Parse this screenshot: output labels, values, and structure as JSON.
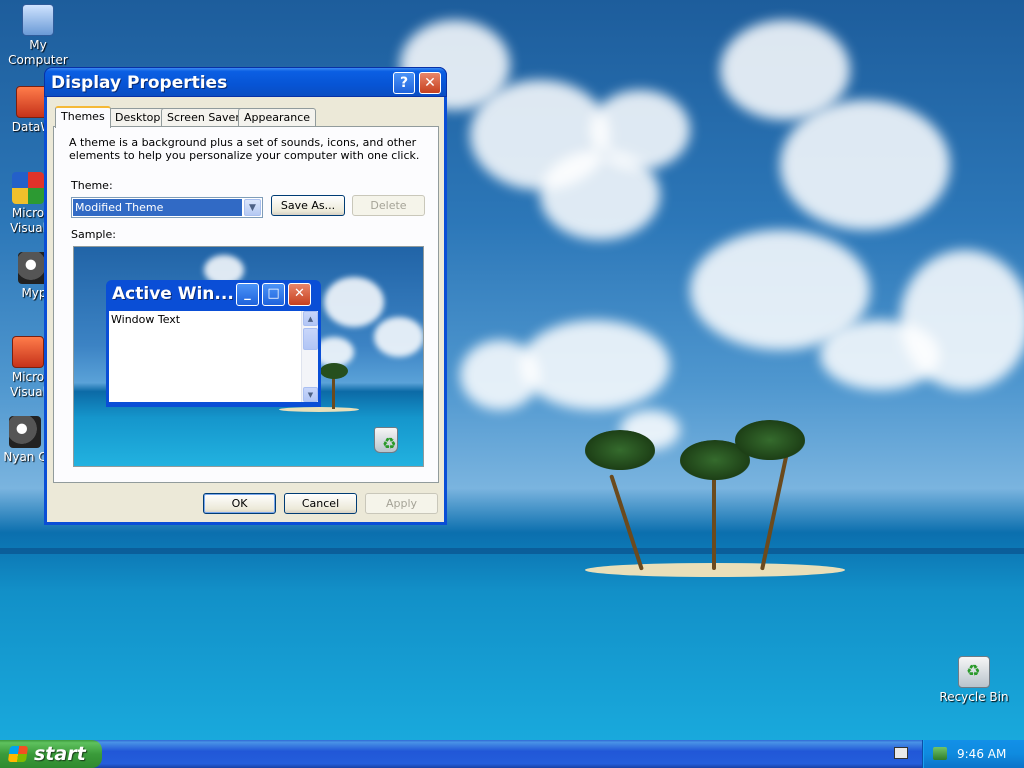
{
  "desktop": {
    "icons": [
      {
        "label": "My Computer",
        "icon": "computer-icon"
      },
      {
        "label": "DataW",
        "icon": "app-shortcut-icon"
      },
      {
        "label": "Micro Visual",
        "icon": "visual-studio-icon"
      },
      {
        "label": "Myp",
        "icon": "cat-icon"
      },
      {
        "label": "Micro Visual",
        "icon": "app-shortcut-icon"
      },
      {
        "label": "Nyan C",
        "icon": "cat-icon"
      },
      {
        "label": "Recycle Bin",
        "icon": "recycle-bin-icon"
      }
    ]
  },
  "dialog": {
    "title": "Display Properties",
    "help_button": "?",
    "close_button": "✕",
    "tabs": [
      {
        "label": "Themes",
        "active": true
      },
      {
        "label": "Desktop"
      },
      {
        "label": "Screen Saver"
      },
      {
        "label": "Appearance"
      }
    ],
    "description": "A theme is a background plus a set of sounds, icons, and other elements to help you personalize your computer with one click.",
    "theme_label": "Theme:",
    "theme_value": "Modified Theme",
    "save_as_button": "Save As...",
    "delete_button": "Delete",
    "sample_label": "Sample:",
    "sample": {
      "window_title": "Active Win...",
      "window_text": "Window Text"
    },
    "ok_button": "OK",
    "cancel_button": "Cancel",
    "apply_button": "Apply"
  },
  "taskbar": {
    "start_label": "start",
    "clock": "9:46 AM"
  }
}
